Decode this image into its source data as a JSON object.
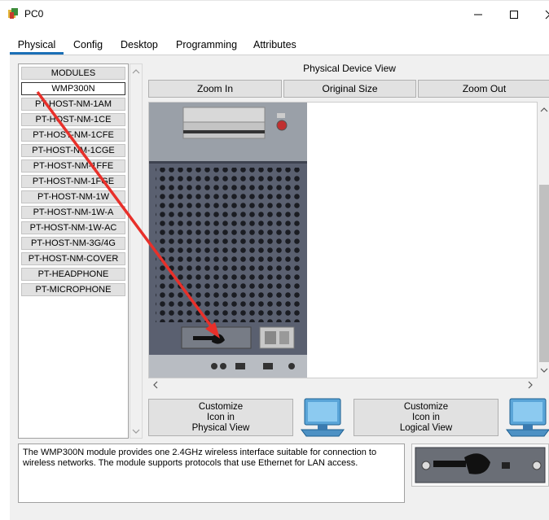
{
  "window": {
    "title": "PC0",
    "minimize": "—",
    "maximize": "☐",
    "close": "✕"
  },
  "tabs": [
    "Physical",
    "Config",
    "Desktop",
    "Programming",
    "Attributes"
  ],
  "modules": {
    "header": "MODULES",
    "items": [
      "WMP300N",
      "PT-HOST-NM-1AM",
      "PT-HOST-NM-1CE",
      "PT-HOST-NM-1CFE",
      "PT-HOST-NM-1CGE",
      "PT-HOST-NM-1FFE",
      "PT-HOST-NM-1FGE",
      "PT-HOST-NM-1W",
      "PT-HOST-NM-1W-A",
      "PT-HOST-NM-1W-AC",
      "PT-HOST-NM-3G/4G",
      "PT-HOST-NM-COVER",
      "PT-HEADPHONE",
      "PT-MICROPHONE"
    ],
    "selected": "WMP300N"
  },
  "view": {
    "title": "Physical Device View",
    "zoom_in": "Zoom In",
    "original_size": "Original Size",
    "zoom_out": "Zoom Out"
  },
  "customize": {
    "physical": "Customize\nIcon in\nPhysical View",
    "logical": "Customize\nIcon in\nLogical View"
  },
  "description": "The WMP300N module provides one 2.4GHz wireless interface suitable for connection to wireless networks. The module supports protocols that use Ethernet for LAN access.",
  "icons": {
    "app": "packet-tracer-icon",
    "pc": "pc-icon",
    "annotation": "red-arrow"
  },
  "colors": {
    "tab_underline": "#1b6fb6",
    "arrow": "#e8302a",
    "chassis": "#4a5060"
  }
}
